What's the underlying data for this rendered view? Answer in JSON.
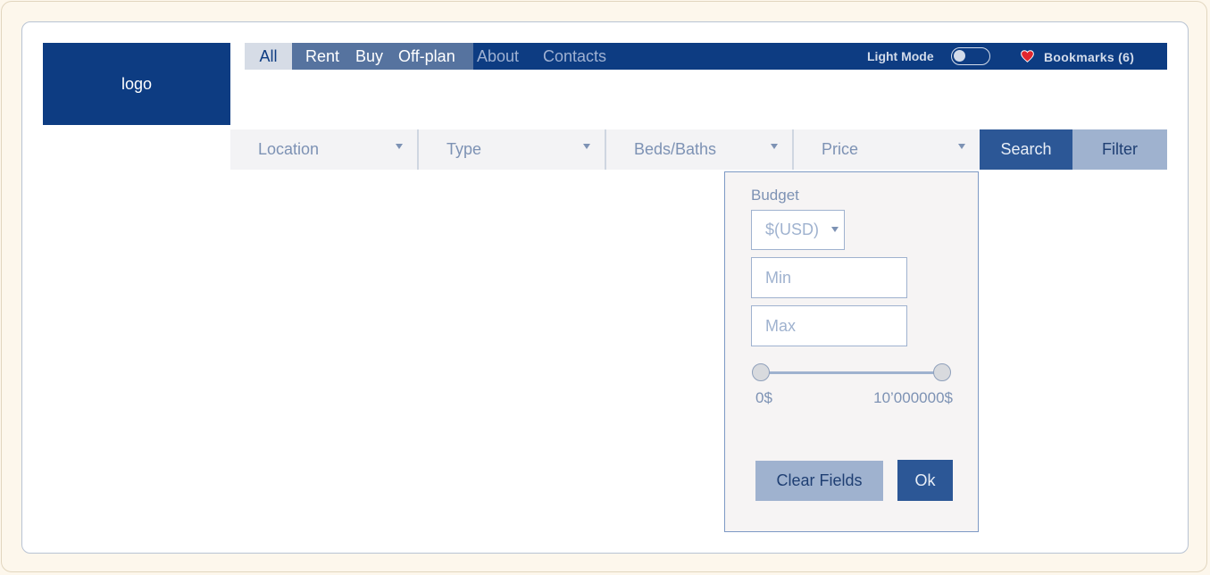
{
  "logo": "logo",
  "nav": {
    "all": "All",
    "rent": "Rent",
    "buy": "Buy",
    "offplan": "Off-plan",
    "about": "About",
    "contacts": "Contacts",
    "light_mode": "Light Mode",
    "light_mode_on": false,
    "bookmarks": "Bookmarks (6)"
  },
  "search": {
    "location": "Location",
    "type": "Type",
    "beds_baths": "Beds/Baths",
    "price": "Price",
    "search_button": "Search",
    "filter_button": "Filter"
  },
  "price_dropdown": {
    "budget_label": "Budget",
    "currency": "$(USD)",
    "min_placeholder": "Min",
    "max_placeholder": "Max",
    "range_min": "0$",
    "range_max": "10’000000$",
    "clear_button": "Clear Fields",
    "ok_button": "Ok"
  },
  "colors": {
    "brand": "#0d3c82",
    "accent": "#2c5796",
    "muted": "#9fb2cf",
    "heart": "#e0262e"
  }
}
